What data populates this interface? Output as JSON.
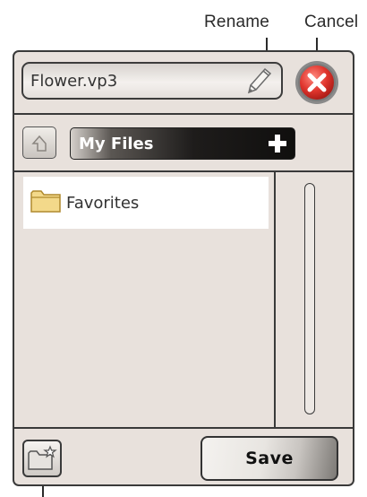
{
  "callouts": {
    "rename": "Rename",
    "cancel": "Cancel"
  },
  "header": {
    "filename_value": "Flower.vp3"
  },
  "navigation": {
    "current_folder": "My Files"
  },
  "file_list": {
    "items": [
      {
        "label": "Favorites",
        "type": "folder",
        "selected": true
      }
    ]
  },
  "footer": {
    "save_label": "Save"
  },
  "colors": {
    "panel_background": "#e8e1dc",
    "cancel_red": "#d9322c",
    "folder_yellow": "#f3d98a",
    "border": "#3a3a3a"
  },
  "icons": [
    "pencil-icon",
    "close-icon",
    "up-arrow-icon",
    "plus-icon",
    "folder-icon",
    "new-folder-icon"
  ]
}
